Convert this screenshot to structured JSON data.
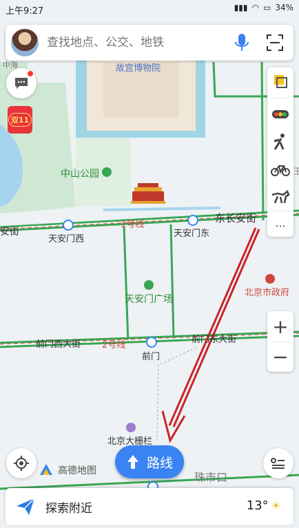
{
  "status_bar": {
    "time": "上午9:27",
    "battery": "34%"
  },
  "search": {
    "placeholder": "查找地点、公交、地铁"
  },
  "promo": {
    "label": "双11"
  },
  "map_labels": {
    "forbidden_city": "故宫博物院",
    "zhongshan_park": "中山公园",
    "line1": "1号线",
    "line2": "2号线",
    "dong_changan": "东长安街",
    "changan_left": "安街",
    "tiananmen_west": "天安门西",
    "tiananmen_east": "天安门东",
    "beijing_govt": "北京市政府",
    "tiananmen_square": "天安门广场",
    "qianmen_west_street": "前门西大街",
    "qianmen_east_street": "前门东大街",
    "qianmen": "前门",
    "dashilan": "北京大栅栏",
    "zhushikou": "珠市口",
    "top_label_1": "中海",
    "top_label_2": "王"
  },
  "controls": {
    "zoom_in": "+",
    "zoom_out": "−",
    "more": "···"
  },
  "logo": {
    "text": "高德地图"
  },
  "route_button": {
    "label": "路线"
  },
  "bottom_bar": {
    "explore_label": "探索附近",
    "temperature": "13°"
  },
  "icons": {
    "avatar": "avatar",
    "mic": "mic-icon",
    "scan": "scan-icon",
    "message": "message-icon",
    "layers": "layers-icon",
    "traffic": "traffic-icon",
    "walk": "walking-icon",
    "bike": "bike-icon",
    "horse": "horse-icon",
    "locate": "locate-icon",
    "list": "list-icon",
    "plane": "paper-plane-icon",
    "weather": "sun-icon"
  },
  "colors": {
    "route_blue": "#3a83f2",
    "subway_line": "#d2453f",
    "road_green": "#3aa655",
    "annotation_arrow": "#cc2229"
  }
}
